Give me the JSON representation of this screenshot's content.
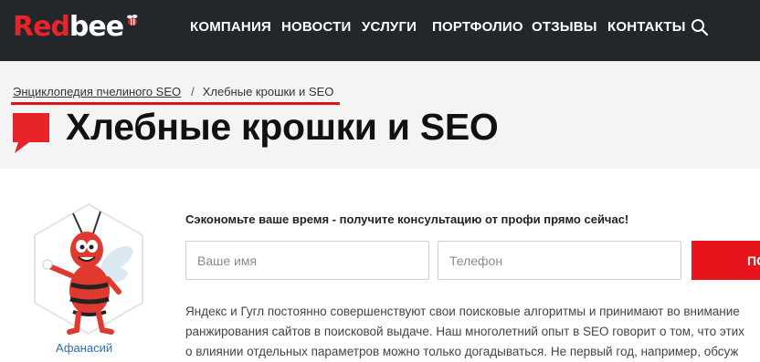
{
  "header": {
    "logo": {
      "part1": "Red",
      "part2": "bee"
    },
    "nav": [
      {
        "label": "КОМПАНИЯ"
      },
      {
        "label": "НОВОСТИ"
      },
      {
        "label": "УСЛУГИ"
      },
      {
        "label": "ПОРТФОЛИО"
      },
      {
        "label": "ОТЗЫВЫ"
      },
      {
        "label": "КОНТАКТЫ"
      }
    ],
    "search_icon": "search-icon"
  },
  "breadcrumb": {
    "items": [
      {
        "label": "Энциклопедия пчелиного SEO"
      },
      {
        "label": "Хлебные крошки и SEO"
      }
    ],
    "separator": "/"
  },
  "page": {
    "title": "Хлебные крошки и SEO"
  },
  "avatar": {
    "name": "Афанасий"
  },
  "form": {
    "cta": "Сэкономьте ваше время - получите консультацию от профи прямо сейчас!",
    "name_placeholder": "Ваше имя",
    "phone_placeholder": "Телефон",
    "submit_label": "ПО"
  },
  "body": {
    "lines": [
      "Яндекс и Гугл постоянно совершенствуют свои поисковые алгоритмы и принимают во внимание",
      "ранжирования сайтов в поисковой выдаче. Наш многолетний опыт в SEO говорит о том, что этих",
      "о влиянии отдельных параметров можно только догадываться. Не первый год, например, обсуж"
    ]
  },
  "colors": {
    "brand_red": "#e8232a",
    "header_bg": "#23262b",
    "hero_bg": "#f4f4f4"
  }
}
